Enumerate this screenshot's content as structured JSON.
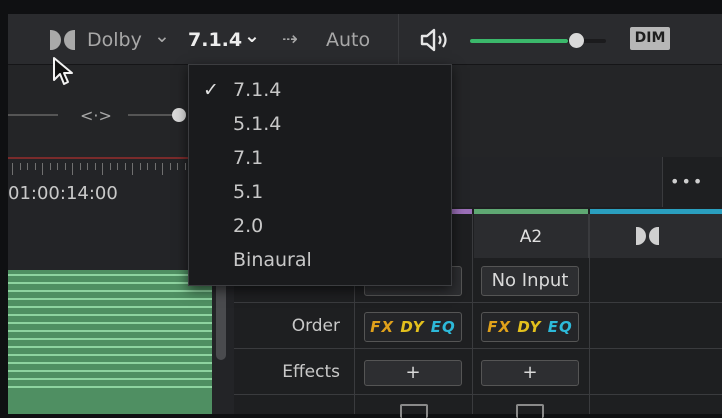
{
  "topbar": {
    "format_label": "Dolby",
    "format_caret": "⌄",
    "channel_config": "7.1.4",
    "channel_caret": "⌄",
    "arrow": "⇢",
    "auto_label": "Auto",
    "volume_level": 0.72,
    "dim_label": "DIM"
  },
  "transport": {
    "nudge_icon": "<·>"
  },
  "dropdown": {
    "selected_mark": "✓",
    "items": [
      "7.1.4",
      "5.1.4",
      "7.1",
      "5.1",
      "2.0",
      "Binaural"
    ]
  },
  "timeline": {
    "timecode": "01:00:14:00",
    "more_icon": "•••"
  },
  "mixer": {
    "columns": [
      "A2"
    ],
    "rows": {
      "input": {
        "value": "No Input"
      },
      "order": {
        "label": "Order",
        "fx": "FX",
        "dy": "DY",
        "eq": "EQ"
      },
      "effects": {
        "label": "Effects",
        "add": "+"
      }
    }
  },
  "colors": {
    "accent_green": "#3bb86b",
    "clip_green": "#4f8f62",
    "purple": "#9b6fb8",
    "teal": "#2a9fbf"
  }
}
